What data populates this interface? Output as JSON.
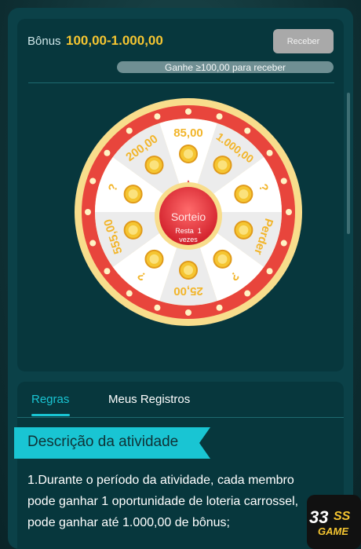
{
  "header": {
    "bonus_label": "Bônus",
    "bonus_range": "100,00-1.000,00",
    "receive_button": "Receber",
    "progress_text": "Ganhe ≥100,00 para receber",
    "progress_value": 0
  },
  "wheel": {
    "segments": [
      "85,00",
      "1.000,00",
      "?",
      "Perder",
      "?",
      "25,00",
      "?",
      "555,00",
      "?",
      "200,00"
    ],
    "center_title": "Sorteio",
    "center_remaining": "Resta  1",
    "center_times": "vezes",
    "colors": {
      "rim": "#e8453c",
      "outer_gold": "#f7d77a",
      "segment_light": "#ffffff",
      "segment_dark": "#ececec",
      "label": "#f2b52a",
      "center": "#e5363b"
    }
  },
  "tabs": [
    {
      "label": "Regras",
      "active": true
    },
    {
      "label": "Meus Registros",
      "active": false
    }
  ],
  "section": {
    "title": "Descrição da atividade",
    "lines": [
      "1.Durante o período da atividade, cada membro",
      "pode ganhar 1 oportunidade de loteria carrossel,",
      "pode ganhar até 1.000,00 de bônus;"
    ]
  },
  "logo": {
    "number": "33",
    "letters": "SS",
    "word": "GAME"
  }
}
